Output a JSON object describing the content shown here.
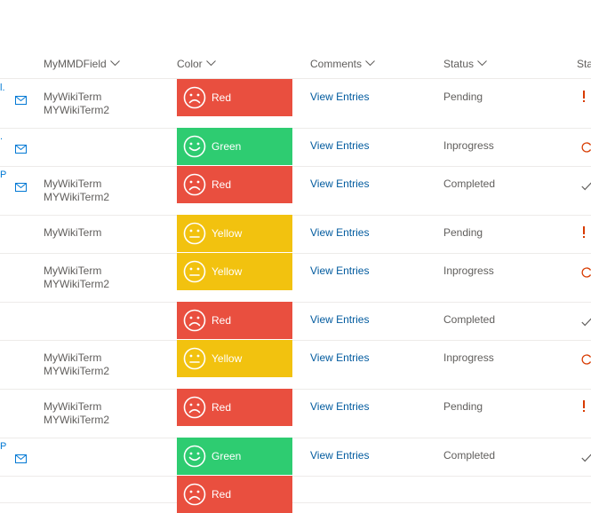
{
  "columns": [
    {
      "label": "MyMMDField"
    },
    {
      "label": "Color"
    },
    {
      "label": "Comments"
    },
    {
      "label": "Status"
    },
    {
      "label": "Sta"
    }
  ],
  "rows": [
    {
      "edge": "l.",
      "mail": true,
      "mmd": [
        "MyWikiTerm",
        "MYWikiTerm2"
      ],
      "color": "Red",
      "comments": "View Entries",
      "status": "Pending",
      "status_icon": "exclamation"
    },
    {
      "edge": ".",
      "mail": true,
      "mmd": [],
      "color": "Green",
      "comments": "View Entries",
      "status": "Inprogress",
      "status_icon": "progress"
    },
    {
      "edge": "P",
      "mail": true,
      "mmd": [
        "MyWikiTerm",
        "MYWikiTerm2"
      ],
      "color": "Red",
      "comments": "View Entries",
      "status": "Completed",
      "status_icon": "check"
    },
    {
      "edge": "",
      "mail": false,
      "mmd": [
        "MyWikiTerm"
      ],
      "color": "Yellow",
      "comments": "View Entries",
      "status": "Pending",
      "status_icon": "exclamation"
    },
    {
      "edge": "",
      "mail": false,
      "mmd": [
        "MyWikiTerm",
        "MYWikiTerm2"
      ],
      "color": "Yellow",
      "comments": "View Entries",
      "status": "Inprogress",
      "status_icon": "progress"
    },
    {
      "edge": "",
      "mail": false,
      "mmd": [],
      "color": "Red",
      "comments": "View Entries",
      "status": "Completed",
      "status_icon": "check"
    },
    {
      "edge": "",
      "mail": false,
      "mmd": [
        "MyWikiTerm",
        "MYWikiTerm2"
      ],
      "color": "Yellow",
      "comments": "View Entries",
      "status": "Inprogress",
      "status_icon": "progress"
    },
    {
      "edge": "",
      "mail": false,
      "mmd": [
        "MyWikiTerm",
        "MYWikiTerm2"
      ],
      "color": "Red",
      "comments": "View Entries",
      "status": "Pending",
      "status_icon": "exclamation"
    },
    {
      "edge": "P",
      "mail": true,
      "mmd": [],
      "color": "Green",
      "comments": "View Entries",
      "status": "Completed",
      "status_icon": "check"
    },
    {
      "edge": "",
      "mail": false,
      "mmd": [],
      "color": "Red",
      "comments": "",
      "status": "",
      "status_icon": ""
    }
  ],
  "colors": {
    "Red": "#e94f3f",
    "Green": "#2ecc71",
    "Yellow": "#f2c20f",
    "link": "#005a9e",
    "status_orange": "#d83b01",
    "accent": "#0078d4"
  }
}
